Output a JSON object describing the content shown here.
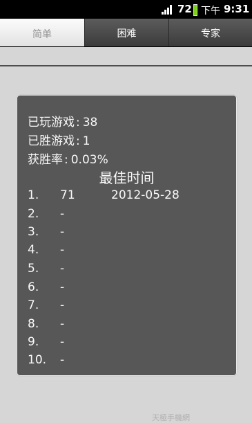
{
  "status_bar": {
    "battery_text": "72",
    "ampm": "下午",
    "time": "9:31"
  },
  "tabs": [
    {
      "label": "简单",
      "active": true
    },
    {
      "label": "困难",
      "active": false
    },
    {
      "label": "专家",
      "active": false
    }
  ],
  "stats": {
    "games_played": {
      "label": "已玩游戏",
      "value": "38"
    },
    "games_won": {
      "label": "已胜游戏",
      "value": "1"
    },
    "win_rate": {
      "label": "获胜率",
      "value": "0.03%"
    }
  },
  "best_times": {
    "title": "最佳时间",
    "rows": [
      {
        "rank": "1.",
        "time": "71",
        "date": "2012-05-28"
      },
      {
        "rank": "2.",
        "time": "-",
        "date": ""
      },
      {
        "rank": "3.",
        "time": "-",
        "date": ""
      },
      {
        "rank": "4.",
        "time": "-",
        "date": ""
      },
      {
        "rank": "5.",
        "time": "-",
        "date": ""
      },
      {
        "rank": "6.",
        "time": "-",
        "date": ""
      },
      {
        "rank": "7.",
        "time": "-",
        "date": ""
      },
      {
        "rank": "8.",
        "time": "-",
        "date": ""
      },
      {
        "rank": "9.",
        "time": "-",
        "date": ""
      },
      {
        "rank": "10.",
        "time": "-",
        "date": ""
      }
    ]
  },
  "watermark": "天極手機網"
}
